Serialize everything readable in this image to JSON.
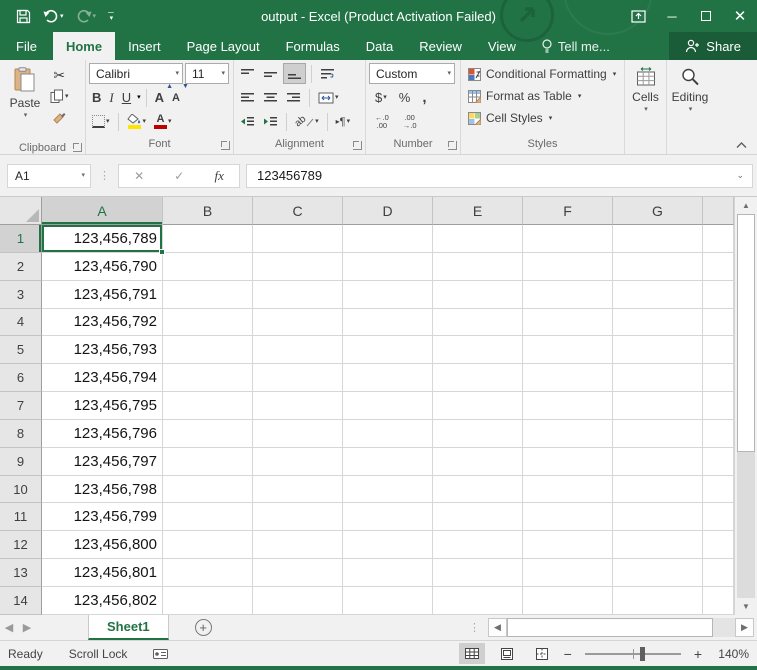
{
  "window": {
    "title": "output - Excel (Product Activation Failed)"
  },
  "menu": {
    "file": "File",
    "items": [
      "Home",
      "Insert",
      "Page Layout",
      "Formulas",
      "Data",
      "Review",
      "View"
    ],
    "active": "Home",
    "tell_me": "Tell me...",
    "share": "Share"
  },
  "ribbon": {
    "clipboard": {
      "group_label": "Clipboard",
      "paste_label": "Paste"
    },
    "font": {
      "group_label": "Font",
      "font_name": "Calibri",
      "font_size": "11",
      "bold": "B",
      "italic": "I",
      "underline": "U",
      "grow": "A",
      "shrink": "A"
    },
    "alignment": {
      "group_label": "Alignment",
      "orientation": "ab",
      "direction": "¶"
    },
    "number": {
      "group_label": "Number",
      "format": "Custom",
      "currency": "$",
      "percent": "%",
      "comma": ",",
      "inc_decimal_top": "←.0",
      "inc_decimal_bot": ".00",
      "dec_decimal_top": ".00",
      "dec_decimal_bot": "→.0"
    },
    "styles": {
      "group_label": "Styles",
      "conditional": "Conditional Formatting",
      "format_table": "Format as Table",
      "cell_styles": "Cell Styles"
    },
    "cells": {
      "label": "Cells"
    },
    "editing": {
      "label": "Editing"
    }
  },
  "formula_bar": {
    "name_box": "A1",
    "fx_label": "fx",
    "value": "123456789"
  },
  "grid": {
    "columns": [
      "A",
      "B",
      "C",
      "D",
      "E",
      "F",
      "G"
    ],
    "selected_column": "A",
    "selected_row": 1,
    "selected_cell": "A1",
    "row_numbers": [
      1,
      2,
      3,
      4,
      5,
      6,
      7,
      8,
      9,
      10,
      11,
      12,
      13,
      14
    ],
    "values": [
      "123,456,789",
      "123,456,790",
      "123,456,791",
      "123,456,792",
      "123,456,793",
      "123,456,794",
      "123,456,795",
      "123,456,796",
      "123,456,797",
      "123,456,798",
      "123,456,799",
      "123,456,800",
      "123,456,801",
      "123,456,802"
    ]
  },
  "sheet_bar": {
    "sheet": "Sheet1"
  },
  "status_bar": {
    "mode": "Ready",
    "scroll_lock": "Scroll Lock",
    "zoom_out": "−",
    "zoom_in": "+",
    "zoom_level": "140%"
  },
  "colors": {
    "excel_green": "#217346",
    "fill_yellow": "#ffe400",
    "font_red": "#c00000"
  }
}
